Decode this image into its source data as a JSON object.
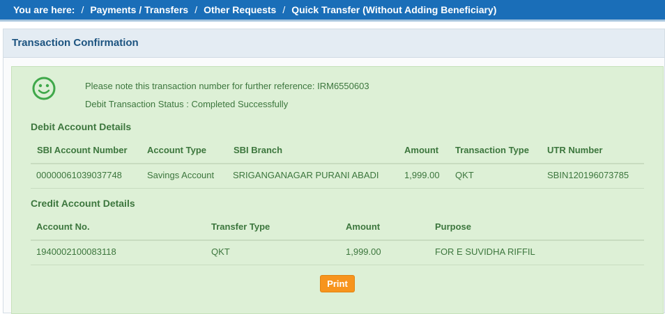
{
  "breadcrumb": {
    "prefix": "You are here:",
    "items": [
      "Payments / Transfers",
      "Other Requests",
      "Quick Transfer (Without Adding Beneficiary)"
    ]
  },
  "panel": {
    "title": "Transaction Confirmation"
  },
  "confirmation": {
    "icon": "smiley-icon",
    "reference_text": "Please note this transaction number for further reference: IRM6550603",
    "status_text": "Debit Transaction Status : Completed Successfully"
  },
  "debit": {
    "title": "Debit Account Details",
    "headers": [
      "SBI Account Number",
      "Account Type",
      "SBI Branch",
      "Amount",
      "Transaction Type",
      "UTR Number"
    ],
    "row": [
      "00000061039037748",
      "Savings Account",
      "SRIGANGANAGAR PURANI ABADI",
      "1,999.00",
      "QKT",
      "SBIN120196073785"
    ]
  },
  "credit": {
    "title": "Credit Account Details",
    "headers": [
      "Account No.",
      "Transfer Type",
      "Amount",
      "Purpose"
    ],
    "row": [
      "1940002100083118",
      "QKT",
      "1,999.00",
      "FOR E SUVIDHA RIFFIL"
    ]
  },
  "actions": {
    "print_label": "Print"
  },
  "colors": {
    "header_blue": "#1a6eb8",
    "success_bg": "#ddf0d6",
    "success_text": "#3c763d",
    "print_button": "#f7941d"
  }
}
